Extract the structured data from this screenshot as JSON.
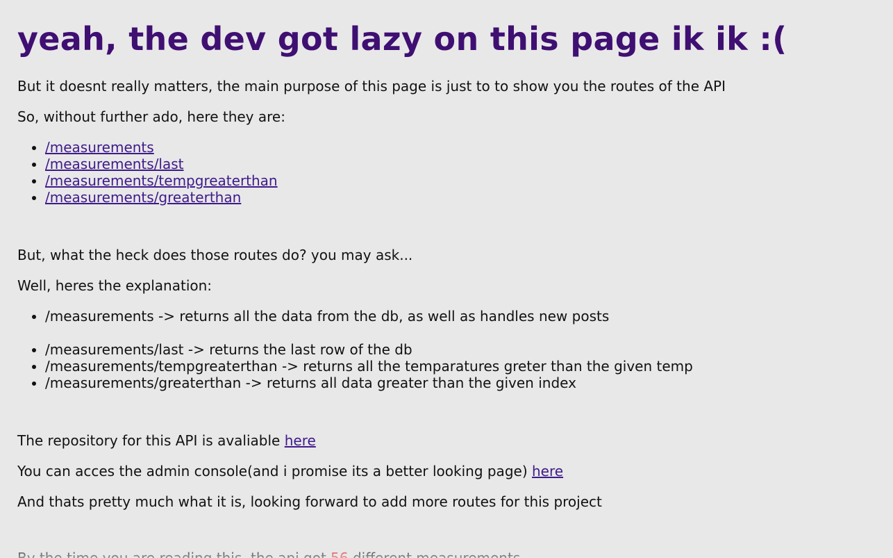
{
  "heading": "yeah, the dev got lazy on this page ik ik :(",
  "intro": "But it doesnt really matters, the main purpose of this page is just to to show you the routes of the API",
  "lead": "So, without further ado, here they are:",
  "routes": [
    "/measurements",
    "/measurements/last",
    "/measurements/tempgreaterthan",
    "/measurements/greaterthan"
  ],
  "question": "But, what the heck does those routes do? you may ask...",
  "explanation_lead": "Well, heres the explanation:",
  "explanations": [
    "/measurements -> returns all the data from the db, as well as handles new posts",
    "/measurements/last -> returns the last row of the db",
    "/measurements/tempgreaterthan -> returns all the temparatures greter than the given temp",
    "/measurements/greaterthan -> returns all data greater than the given index"
  ],
  "repo": {
    "text": "The repository for this API is avaliable ",
    "link": "here"
  },
  "admin": {
    "text": "You can acces the admin console(and i promise its a better looking page) ",
    "link": "here"
  },
  "closing": "And thats pretty much what it is, looking forward to add more routes for this project",
  "counter": {
    "before": "By the time you are reading this, the api got ",
    "count": "56",
    "after": " different measurements"
  },
  "colors": {
    "heading": "#3f0f72",
    "link": "#3f1a8a",
    "count": "#e0201e",
    "background": "#e8e8e8"
  }
}
